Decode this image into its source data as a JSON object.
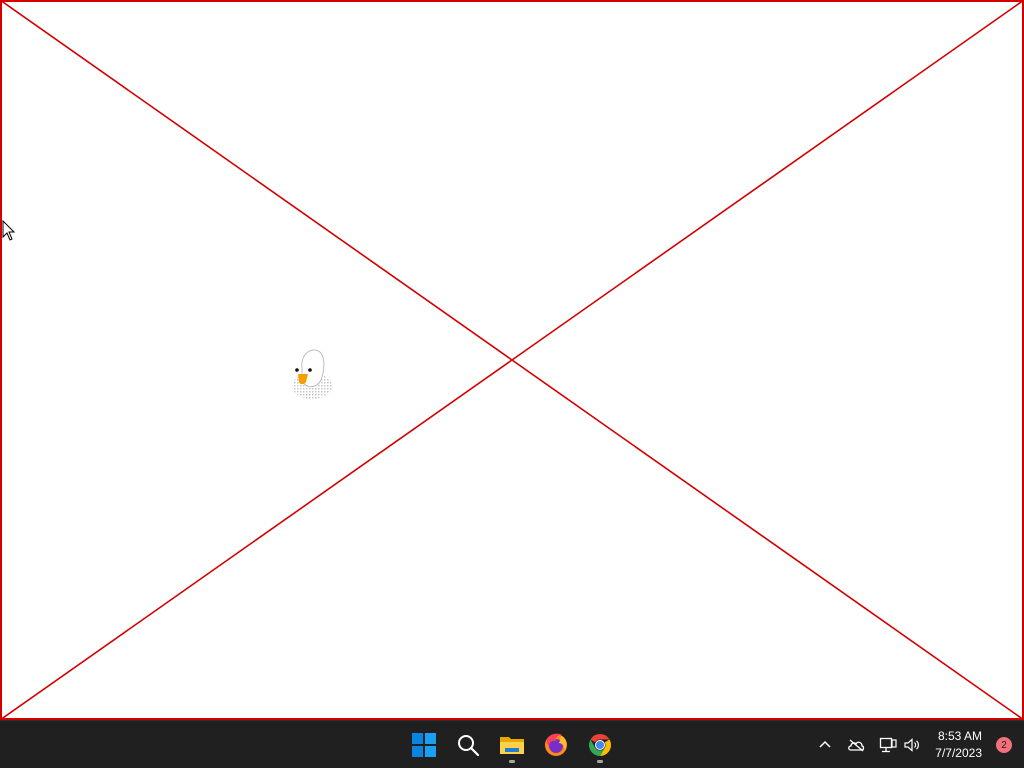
{
  "desktop": {
    "frame_color": "#d40000"
  },
  "taskbar": {
    "background": "#202020",
    "pinned": [
      {
        "name": "start",
        "icon": "windows-logo-icon",
        "running": false
      },
      {
        "name": "search",
        "icon": "search-icon",
        "running": false
      },
      {
        "name": "file-explorer",
        "icon": "folder-icon",
        "running": true
      },
      {
        "name": "firefox",
        "icon": "firefox-icon",
        "running": false
      },
      {
        "name": "chrome",
        "icon": "chrome-icon",
        "running": true
      }
    ],
    "tray": {
      "icons": [
        "chevron-up-icon",
        "onedrive-offline-icon",
        "network-icon",
        "volume-icon"
      ],
      "time": "8:53 AM",
      "date": "7/7/2023",
      "notification_count": "2"
    }
  }
}
